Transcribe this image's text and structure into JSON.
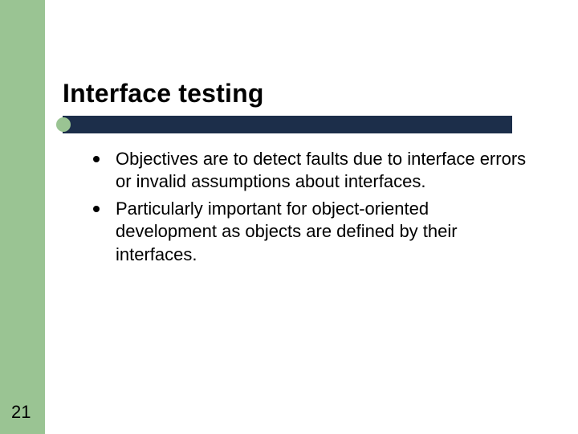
{
  "slide": {
    "title": "Interface testing",
    "bullets": [
      "Objectives are to detect faults due to interface errors or invalid assumptions about interfaces.",
      "Particularly important for object-oriented development as objects are defined by their interfaces."
    ],
    "page_number": "21"
  }
}
